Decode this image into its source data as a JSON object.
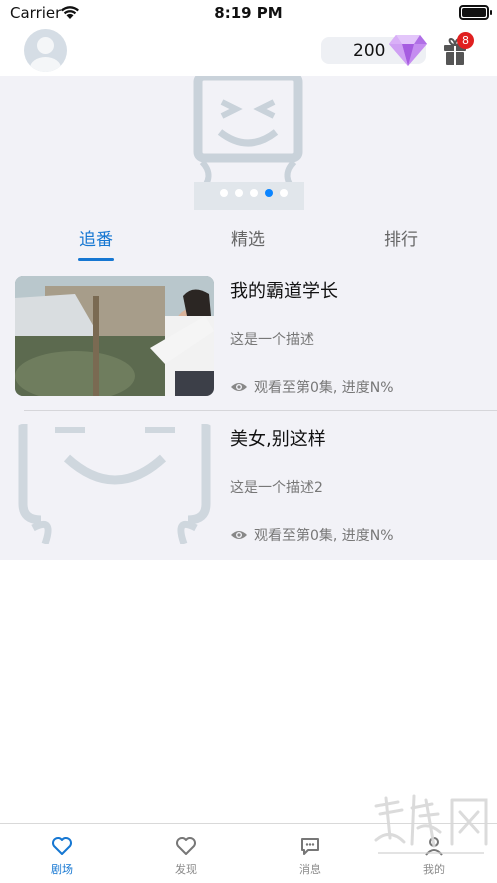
{
  "status_bar": {
    "carrier": "Carrier",
    "time": "8:19 PM",
    "battery_level": 1.0
  },
  "header": {
    "coins": "200",
    "gift_badge": "8"
  },
  "banner": {
    "slide_count": 5,
    "active_slide": 3
  },
  "tabs": [
    {
      "label": "追番",
      "active": true
    },
    {
      "label": "精选",
      "active": false
    },
    {
      "label": "排行",
      "active": false
    }
  ],
  "items": [
    {
      "title": "我的霸道学长",
      "description": "这是一个描述",
      "progress": "观看至第0集, 进度N%"
    },
    {
      "title": "美女,别这样",
      "description": "这是一个描述2",
      "progress": "观看至第0集, 进度N%"
    }
  ],
  "tabbar": [
    {
      "label": "剧场",
      "icon": "heart-icon",
      "active": true
    },
    {
      "label": "发现",
      "icon": "heart-icon",
      "active": false
    },
    {
      "label": "消息",
      "icon": "message-icon",
      "active": false
    },
    {
      "label": "我的",
      "icon": "user-icon",
      "active": false
    }
  ],
  "colors": {
    "accent": "#1677d2",
    "badge": "#e02020",
    "list_bg": "#f2f2f7"
  }
}
